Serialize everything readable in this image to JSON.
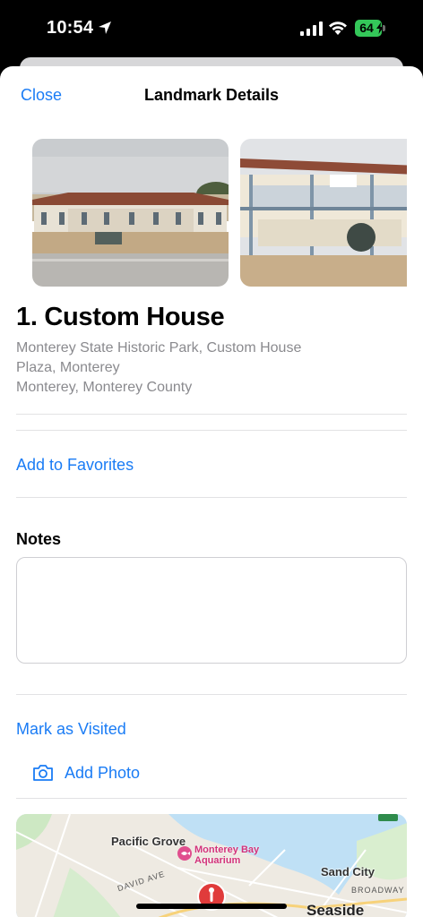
{
  "status_bar": {
    "time": "10:54",
    "battery": "64"
  },
  "nav": {
    "close_label": "Close",
    "title": "Landmark Details"
  },
  "landmark": {
    "name": "1. Custom House",
    "address": "Monterey State Historic Park, Custom House Plaza, Monterey",
    "region": "Monterey, Monterey County"
  },
  "actions": {
    "favorites_label": "Add to Favorites",
    "visited_label": "Mark as Visited",
    "add_photo_label": "Add Photo"
  },
  "notes": {
    "label": "Notes",
    "value": "",
    "placeholder": ""
  },
  "map": {
    "labels": {
      "pacific_grove": "Pacific Grove",
      "aquarium": "Monterey Bay Aquarium",
      "sand_city": "Sand City",
      "seaside": "Seaside",
      "david_ave": "DAVID AVE",
      "broadway": "BROADWAY"
    }
  },
  "colors": {
    "accent": "#1a7cf5",
    "battery": "#34c759",
    "secondary_text": "#8a8a8e",
    "pin": "#e03b3b"
  }
}
